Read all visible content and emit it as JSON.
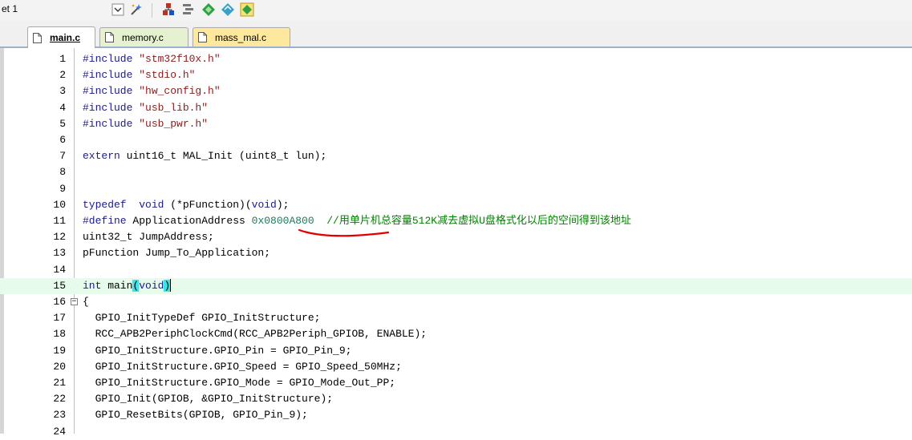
{
  "toolbar": {
    "target_label": "et 1",
    "icons": [
      "dropdown-arrow-icon",
      "magic-wand-icon",
      "build-target-icon",
      "options-icon",
      "diamond-icon",
      "manage-icon",
      "batch-build-icon"
    ]
  },
  "tabs": [
    {
      "label": "main.c",
      "active": true,
      "color": "#ffffff"
    },
    {
      "label": "memory.c",
      "active": false,
      "color": "#e6f1cf"
    },
    {
      "label": "mass_mal.c",
      "active": false,
      "color": "#fde89e"
    }
  ],
  "editor": {
    "current_line": 15,
    "lines": [
      {
        "n": "1",
        "text": "#include \"stm32f10x.h\""
      },
      {
        "n": "2",
        "text": "#include \"stdio.h\""
      },
      {
        "n": "3",
        "text": "#include \"hw_config.h\""
      },
      {
        "n": "4",
        "text": "#include \"usb_lib.h\""
      },
      {
        "n": "5",
        "text": "#include \"usb_pwr.h\""
      },
      {
        "n": "6",
        "text": ""
      },
      {
        "n": "7",
        "text": "extern uint16_t MAL_Init (uint8_t lun);"
      },
      {
        "n": "8",
        "text": ""
      },
      {
        "n": "9",
        "text": ""
      },
      {
        "n": "10",
        "text": "typedef  void (*pFunction)(void);"
      },
      {
        "n": "11",
        "text": "#define ApplicationAddress 0x0800A800  //用单片机总容量512K减去虚拟U盘格式化以后的空间得到该地址"
      },
      {
        "n": "12",
        "text": "uint32_t JumpAddress;"
      },
      {
        "n": "13",
        "text": "pFunction Jump_To_Application;"
      },
      {
        "n": "14",
        "text": ""
      },
      {
        "n": "15",
        "text": "int main(void)"
      },
      {
        "n": "16",
        "text": "{"
      },
      {
        "n": "17",
        "text": "  GPIO_InitTypeDef GPIO_InitStructure;"
      },
      {
        "n": "18",
        "text": "  RCC_APB2PeriphClockCmd(RCC_APB2Periph_GPIOB, ENABLE);"
      },
      {
        "n": "19",
        "text": "  GPIO_InitStructure.GPIO_Pin = GPIO_Pin_9;"
      },
      {
        "n": "20",
        "text": "  GPIO_InitStructure.GPIO_Speed = GPIO_Speed_50MHz;"
      },
      {
        "n": "21",
        "text": "  GPIO_InitStructure.GPIO_Mode = GPIO_Mode_Out_PP;"
      },
      {
        "n": "22",
        "text": "  GPIO_Init(GPIOB, &GPIO_InitStructure);"
      },
      {
        "n": "23",
        "text": "  GPIO_ResetBits(GPIOB, GPIO_Pin_9);"
      },
      {
        "n": "24",
        "text": ""
      }
    ],
    "highlighted_code": {
      "define_kw": "#define",
      "define_name": " ApplicationAddress ",
      "define_value": "0x0800A800",
      "define_comment": "  //用单片机总容量512K减去虚拟U盘格式化以后的空间得到该地址",
      "main_kw": "int",
      "main_name": " main",
      "main_open": "(",
      "main_arg": "void",
      "main_close": ")"
    },
    "annotation_color": "#e00000"
  }
}
